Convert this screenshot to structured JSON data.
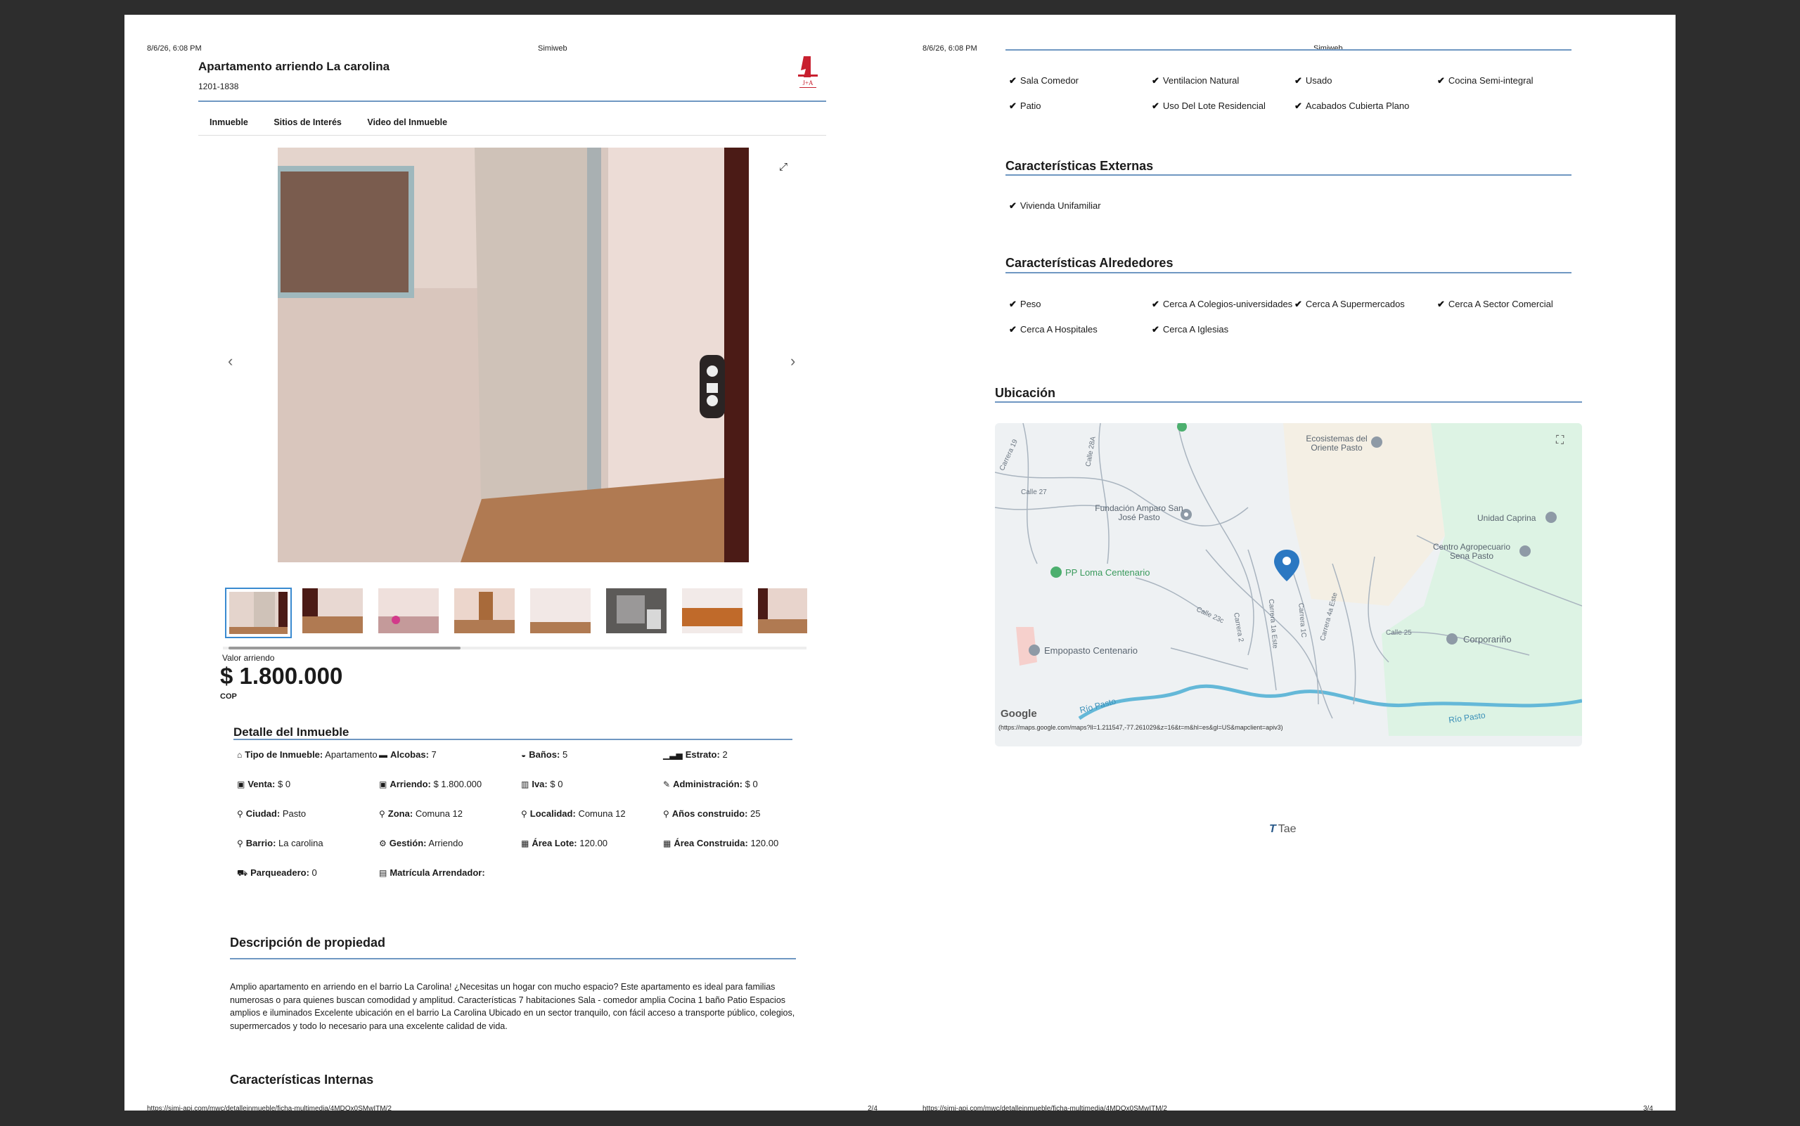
{
  "pages": {
    "left": {
      "header_date": "8/6/26, 6:08 PM",
      "header_site": "Simiweb",
      "footer_url": "https://simi-api.com/mwc/detalleinmueble/ficha-multimedia/4MDOx0SMwITM/2",
      "footer_page": "2/4"
    },
    "right": {
      "header_date": "8/6/26, 6:08 PM",
      "header_site": "Simiweb",
      "footer_url": "https://simi-api.com/mwc/detalleinmueble/ficha-multimedia/4MDOx0SMwITM/2",
      "footer_page": "3/4"
    }
  },
  "property": {
    "title": "Apartamento arriendo La carolina",
    "code": "1201-1838",
    "logo_text": "J+A"
  },
  "tabs": [
    "Inmueble",
    "Sitios de Interés",
    "Video del Inmueble"
  ],
  "price": {
    "label": "Valor arriendo",
    "value": "$ 1.800.000",
    "currency": "COP"
  },
  "details": {
    "title": "Detalle del Inmueble",
    "rows": [
      [
        {
          "icon": "home-icon",
          "glyph": "⌂",
          "label": "Tipo de Inmueble:",
          "value": "Apartamento"
        },
        {
          "icon": "bed-icon",
          "glyph": "▬",
          "label": "Alcobas:",
          "value": "7"
        },
        {
          "icon": "bath-icon",
          "glyph": "◒",
          "label": "Baños:",
          "value": "5"
        },
        {
          "icon": "signal-icon",
          "glyph": "▁▃▅",
          "label": "Estrato:",
          "value": "2"
        }
      ],
      [
        {
          "icon": "money-icon",
          "glyph": "▣",
          "label": "Venta:",
          "value": "$ 0"
        },
        {
          "icon": "money-icon",
          "glyph": "▣",
          "label": "Arriendo:",
          "value": "$ 1.800.000"
        },
        {
          "icon": "barcode-icon",
          "glyph": "▥",
          "label": "Iva:",
          "value": "$ 0"
        },
        {
          "icon": "wrench-icon",
          "glyph": "✎",
          "label": "Administración:",
          "value": "$ 0"
        }
      ],
      [
        {
          "icon": "map-marker-icon",
          "glyph": "⚲",
          "label": "Ciudad:",
          "value": "Pasto"
        },
        {
          "icon": "map-marker-icon",
          "glyph": "⚲",
          "label": "Zona:",
          "value": "Comuna 12"
        },
        {
          "icon": "map-marker-icon",
          "glyph": "⚲",
          "label": "Localidad:",
          "value": "Comuna 12"
        },
        {
          "icon": "map-marker-icon",
          "glyph": "⚲",
          "label": "Años construido:",
          "value": "25"
        }
      ],
      [
        {
          "icon": "map-marker-icon",
          "glyph": "⚲",
          "label": "Barrio:",
          "value": "La carolina"
        },
        {
          "icon": "cogs-icon",
          "glyph": "⚙",
          "label": "Gestión:",
          "value": "Arriendo"
        },
        {
          "icon": "area-icon",
          "glyph": "▦",
          "label": "Área Lote:",
          "value": "120.00"
        },
        {
          "icon": "area-icon",
          "glyph": "▦",
          "label": "Área Construida:",
          "value": "120.00"
        }
      ],
      [
        {
          "icon": "car-icon",
          "glyph": "⛟",
          "label": "Parqueadero:",
          "value": "0"
        },
        {
          "icon": "id-card-icon",
          "glyph": "▤",
          "label": "Matrícula Arrendador:",
          "value": ""
        },
        null,
        null
      ]
    ]
  },
  "description": {
    "title": "Descripción de propiedad",
    "text": "Amplio apartamento en arriendo en el barrio La Carolina! ¿Necesitas un hogar con mucho espacio? Este apartamento es ideal para familias numerosas o para quienes buscan comodidad y amplitud. Características 7 habitaciones Sala - comedor amplia Cocina 1 baño Patio Espacios amplios e iluminados Excelente ubicación en el barrio La Carolina Ubicado en un sector tranquilo, con fácil acceso a transporte público, colegios, supermercados y todo lo necesario para una excelente calidad de vida."
  },
  "internas": {
    "title": "Características Internas",
    "items": [
      "Sala Comedor",
      "Ventilacion Natural",
      "Usado",
      "Cocina Semi-integral",
      "Patio",
      "Uso Del Lote Residencial",
      "Acabados Cubierta Plano"
    ]
  },
  "externas": {
    "title": "Características Externas",
    "items": [
      "Vivienda Unifamiliar"
    ]
  },
  "alrededores": {
    "title": "Características Alrededores",
    "items": [
      "Peso",
      "Cerca A Colegios-universidades",
      "Cerca A Supermercados",
      "Cerca A Sector Comercial",
      "Cerca A Hospitales",
      "Cerca A Iglesias"
    ]
  },
  "ubicacion": {
    "title": "Ubicación"
  },
  "map": {
    "labels": {
      "ecosistemas": "Ecosistemas del Oriente Pasto",
      "fundacion": "Fundación Amparo San José Pasto",
      "unidad": "Unidad Caprina",
      "centro": "Centro Agropecuario Sena Pasto",
      "loma": "PP Loma Centenario",
      "empopasto": "Empopasto Centenario",
      "corporanino": "Corporariño",
      "rio1": "Río Pasto",
      "rio2": "Río Pasto",
      "calle27": "Calle 27",
      "calle25": "Calle 25",
      "calle23c": "Calle 23c",
      "carrera2": "Carrera 2",
      "carrera1a": "Carrera 1a Este",
      "carrera1c": "Carrera 1C",
      "carrera4a": "Carrera 4a Este",
      "carrera19": "Carrera 19",
      "calle28a": "Calle 28A",
      "google": "Google",
      "url_line": "(https://maps.google.com/maps?ll=1.211547,-77.261029&z=16&t=m&hl=es&gl=US&mapclient=apiv3)"
    }
  },
  "footer_logo": "Tae",
  "colors": {
    "rule": "#6f97c2",
    "map_water": "#64b8d8",
    "map_park": "#ddf3e4",
    "map_sand": "#f4efe4",
    "pin": "#2b78c2"
  }
}
